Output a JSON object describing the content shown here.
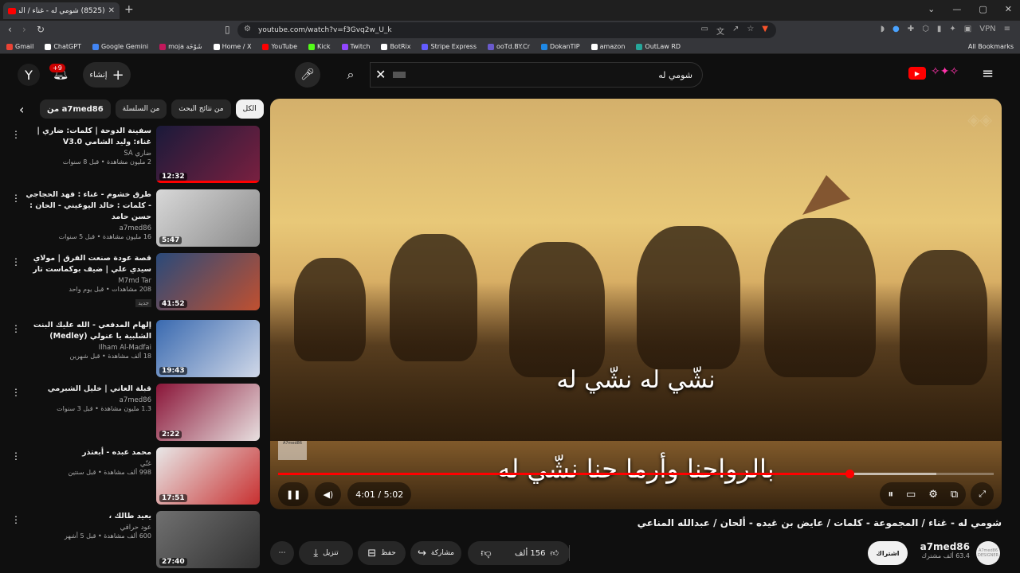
{
  "browser": {
    "tab_title": "(8525) شومي له - غناء / المـ",
    "url": "youtube.com/watch?v=f3Gvq2w_U_k",
    "bookmarks": [
      "Gmail",
      "ChatGPT",
      "Google Gemini",
      "moja شَوْخَة",
      "Home / X",
      "YouTube",
      "Kick",
      "Twitch",
      "BotRix",
      "Stripe Express",
      "ooTd.BY.Cr",
      "DokanTIP",
      "amazon",
      "OutLaw RD"
    ],
    "bookmark_colors": [
      "#ea4335",
      "#ffffff",
      "#4285f4",
      "#c2185b",
      "#ffffff",
      "#ff0000",
      "#53fc18",
      "#9146ff",
      "#ffffff",
      "#635bff",
      "#6a5acd",
      "#1e88e5",
      "#ffffff",
      "#26a69a"
    ],
    "all_bookmarks": "All Bookmarks",
    "vpn": "VPN"
  },
  "header": {
    "avatar_letter": "Y",
    "notif_badge": "+9",
    "create_label": "إنشاء",
    "search_query": "شومي له",
    "accent": "#ff0000"
  },
  "chips": {
    "all": "الكل",
    "from_results": "من نتائج البحث",
    "from_series": "من السلسلة",
    "from_channel": "من a7med86"
  },
  "suggestions": [
    {
      "title": "سفينة الدوحة | كلمات: ضاري | غناء: وليد الشامي V3.0",
      "channel": "ضاري SA",
      "meta": "2 مليون مشاهدة • قبل 8 سنوات",
      "duration": "12:32",
      "colors": [
        "#1a1a3a",
        "#7a2040"
      ],
      "progress": 1
    },
    {
      "title": "طرق خشوم - غناء : فهد الحجاجي - كلمات : خالد اليوعيني - الحان : حسن حامد",
      "channel": "a7med86",
      "meta": "16 مليون مشاهدة • قبل 5 سنوات",
      "duration": "5:47",
      "colors": [
        "#d8d8d8",
        "#8a8a8a"
      ],
      "progress": 0
    },
    {
      "title": "قصة عودة صنعت الفرق | مولاي سيدي علي | ضيف بوكماست تار",
      "channel": "M7md Tar",
      "meta": "208 مشاهدات • قبل يوم واحد",
      "duration": "41:52",
      "colors": [
        "#2a4a7a",
        "#c05030"
      ],
      "progress": 0,
      "tag": "جديد"
    },
    {
      "title": "إلهام المدفعي - الله عليك البنت الشلبية يا عنولي (Medley)",
      "channel": "Ilham Al-Madfai",
      "meta": "18 ألف مشاهدة • قبل شهرين",
      "duration": "19:43",
      "colors": [
        "#3a6ab0",
        "#d0d8e8"
      ],
      "progress": 0
    },
    {
      "title": "قبلة العاني | خليل الشبرمي",
      "channel": "a7med86",
      "meta": "1.3 مليون مشاهدة • قبل 3 سنوات",
      "duration": "2:22",
      "colors": [
        "#8a1538",
        "#e8e0e0"
      ],
      "progress": 0
    },
    {
      "title": "محمد عبده - أبعتذر",
      "channel": "غنّي",
      "meta": "998 ألف مشاهدة • قبل سنتين",
      "duration": "17:51",
      "colors": [
        "#e8e8e8",
        "#c83030"
      ],
      "progress": 0
    },
    {
      "title": "يعيد طالك ،",
      "channel": "عود حراقي",
      "meta": "600 ألف مشاهدة • قبل 5 أشهر",
      "duration": "27:40",
      "colors": [
        "#707070",
        "#303030"
      ],
      "progress": 0
    }
  ],
  "player": {
    "subtitle_1": "نشّي له نشّي له",
    "subtitle_2": "بالرواحنا وأرما حنا نشّي له",
    "logo_text": "A7med86",
    "time": "4:01 / 5:02",
    "progress": 0.7985
  },
  "video": {
    "title": "شومي له - غناء / المجموعة - كلمات / عايض بن غيده - ألحان / عبدالله المناعي",
    "likes": "156 ألف",
    "share": "مشاركة",
    "save": "حفظ",
    "download": "تنزيل",
    "subscribe": "اشتراك",
    "channel": "a7med86",
    "subscribers": "63.4 ألف مشترك",
    "channel_avatar_text": "A7med86 DESIGNER"
  }
}
